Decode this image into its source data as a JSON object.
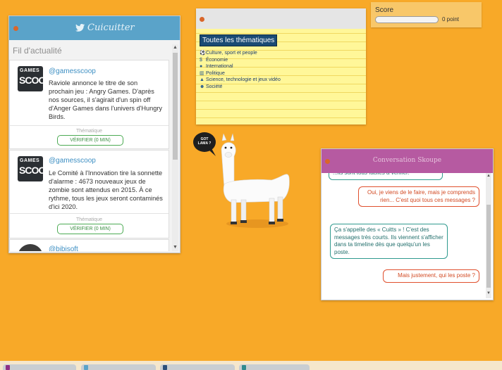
{
  "cuicuitter": {
    "brand": "Cuicuitter",
    "feed_title": "Fil d'actualité",
    "posts": [
      {
        "handle": "@gamesscoop",
        "avatar_top": "GAMES",
        "avatar_bottom": "SCOOP",
        "text": "Raviole annonce le titre de son prochain jeu : Angry Games. D'après nos sources, il s'agirait d'un spin off d'Anger Games dans l'univers d'Hungry Birds.",
        "theme_label": "Thématique",
        "verify_label": "VÉRIFIER (0 MIN)"
      },
      {
        "handle": "@gamesscoop",
        "avatar_top": "GAMES",
        "avatar_bottom": "SCOOP",
        "text": "Le Comité à l'Innovation tire la sonnette d'alarme : 4673 nouveaux jeux de zombie sont attendus en 2015. À ce rythme, tous les jeux seront contaminés d'ici 2020.",
        "theme_label": "Thématique",
        "verify_label": "VÉRIFIER (0 MIN)"
      },
      {
        "handle": "@bibisoft"
      }
    ]
  },
  "themes": {
    "selected": "Toutes les thématiques",
    "items": [
      {
        "icon": "ball-icon",
        "label": "Culture, sport et people"
      },
      {
        "icon": "money-icon",
        "label": "Économie"
      },
      {
        "icon": "globe-icon",
        "label": "International"
      },
      {
        "icon": "building-icon",
        "label": "Politique"
      },
      {
        "icon": "flask-icon",
        "label": "Science, technologie et jeux vidéo"
      },
      {
        "icon": "people-icon",
        "label": "Société"
      }
    ]
  },
  "score": {
    "label": "Score",
    "value": "0 point",
    "progress": 0
  },
  "llama": {
    "speech": "GOT LAMA ?"
  },
  "skoupe": {
    "title": "Conversation Skoupe",
    "messages": [
      {
        "side": "left",
        "text": "...ils sont tous faciles à vérifier."
      },
      {
        "side": "right",
        "text": "Oui, je viens de le faire, mais je comprends rien... C'est quoi tous ces messages ?"
      },
      {
        "side": "left",
        "text": "Ça s'appelle des « Cuitts » ! C'est des messages très courts. Ils viennent s'afficher dans ta timeline dès que quelqu'un les poste."
      },
      {
        "side": "right",
        "text": "Mais justement, qui les poste ?"
      }
    ]
  },
  "taskbar": {
    "colors": [
      "#8e2f86",
      "#5aa3c9",
      "#2c4f7a",
      "#2f8a8e"
    ]
  }
}
